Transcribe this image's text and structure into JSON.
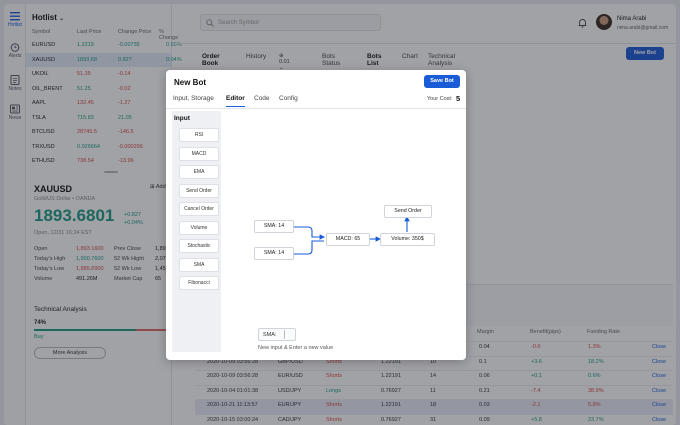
{
  "rail": {
    "items": [
      {
        "label": "Hotlist",
        "icon": "list-icon"
      },
      {
        "label": "Alerts",
        "icon": "alarm-clock-icon"
      },
      {
        "label": "Notes",
        "icon": "notes-icon"
      },
      {
        "label": "News",
        "icon": "news-icon"
      }
    ]
  },
  "hotlist": {
    "title": "Hotlist",
    "headers": [
      "Symbol",
      "Last Price",
      "Change Price",
      "% Change"
    ],
    "rows": [
      {
        "symbol": "EURUSD",
        "last": "1.2219",
        "change": "-0.00735",
        "pct": "0.60%",
        "dir": "up"
      },
      {
        "symbol": "XAUUSD",
        "last": "1893.68",
        "change": "0.827",
        "pct": "0.04%",
        "dir": "up"
      },
      {
        "symbol": "UKOIL",
        "last": "51.35",
        "change": "-0.14",
        "pct": "-0.27%",
        "dir": "down"
      },
      {
        "symbol": "OIL_BRENT",
        "last": "51.25",
        "change": "-0.02",
        "pct": "-0.04%",
        "dir": "mixed"
      },
      {
        "symbol": "AAPL",
        "last": "132.45",
        "change": "-1.27",
        "pct": "-0.95%",
        "dir": "down"
      },
      {
        "symbol": "TSLA",
        "last": "715.83",
        "change": "21.05",
        "pct": "3.03%",
        "dir": "up"
      },
      {
        "symbol": "BTCUSD",
        "last": "28745.5",
        "change": "-146.5",
        "pct": "-0.51%",
        "dir": "down"
      },
      {
        "symbol": "TRXUSD",
        "last": "0.026664",
        "change": "-0.000296",
        "pct": "-1.10%",
        "dir": "mixed"
      },
      {
        "symbol": "ETHUSD",
        "last": "738.54",
        "change": "-13.96",
        "pct": "-1.86%",
        "dir": "down"
      }
    ]
  },
  "detail": {
    "symbol": "XAUUSD",
    "add_label": "Add",
    "subtitle": "Gold/US Dollar • OANDA",
    "price": "1893.6801",
    "change_abs": "+0.827",
    "change_pct": "+0.04%",
    "open_time": "Open, 12/31  16:24 EST",
    "stats_left": [
      {
        "label": "Open",
        "value": "1,893.1600"
      },
      {
        "label": "Today's High",
        "value": "1,900.7600"
      },
      {
        "label": "Today's Low",
        "value": "1,885.6900"
      },
      {
        "label": "Volume",
        "value": "491.26M"
      }
    ],
    "stats_right": [
      {
        "label": "Prev Close",
        "value": "1,893"
      },
      {
        "label": "52 Wk Hight",
        "value": "2,072"
      },
      {
        "label": "52 Wk Low",
        "value": "1,451"
      },
      {
        "label": "Market Cap",
        "value": "65"
      }
    ],
    "ta_title": "Technical Analysis",
    "ta_pct": "74%",
    "ta_label": "Buy",
    "ta_fraction": 0.74,
    "more_label": "More Analysis"
  },
  "topbar": {
    "search_placeholder": "Search Symbol",
    "user_name": "Nima Arabi",
    "user_email": "nima.arabi@gmail.com"
  },
  "tabs_left": {
    "items": [
      "Order Book",
      "History"
    ],
    "step_value": "0.01"
  },
  "tabs_right": {
    "items": [
      "Bots Status",
      "Bots List",
      "Chart",
      "Technical Analysis"
    ],
    "new_bot_label": "New Bot"
  },
  "modal": {
    "title": "New Bot",
    "save_label": "Save Bot",
    "tabs": [
      "Input, Storage",
      "Editor",
      "Code",
      "Config"
    ],
    "your_cost_label": "Your Cost:",
    "your_cost_value": "5",
    "palette_title": "Input",
    "palette": [
      "RSI",
      "MACD",
      "EMA",
      "Send Order",
      "Cancel Order",
      "Volume",
      "Stochastic",
      "SMA",
      "Fibonacci"
    ],
    "nodes": {
      "sma1": "SMA: 14",
      "sma2": "SMA: 14",
      "macd": "MACD: 65",
      "volume": "Volume: 350$",
      "send": "Send Order"
    },
    "input_label": "SMA:",
    "input_hint": "New input & Enter a new value"
  },
  "bottom_table": {
    "headers": [
      "Margin",
      "Benefit(pips)",
      "Funding Rate"
    ],
    "rows": [
      {
        "date": "",
        "pair": "",
        "side": "",
        "price": "",
        "qty": "14",
        "margin": "0.04",
        "benefit": "-0.6",
        "rate": "1.3%",
        "action": "Close",
        "bdir": "down",
        "rdir": "down",
        "sdir": "long"
      },
      {
        "date": "2020-10-09 03:56:28",
        "pair": "GBP/USD",
        "side": "Shorts",
        "price": "1.22191",
        "qty": "10",
        "margin": "0.1",
        "benefit": "+3.6",
        "rate": "18.2%",
        "action": "Close",
        "bdir": "up",
        "rdir": "up",
        "sdir": "short"
      },
      {
        "date": "2020-10-09 03:56:28",
        "pair": "EUR/USD",
        "side": "Shorts",
        "price": "1.22191",
        "qty": "14",
        "margin": "0.06",
        "benefit": "+0.1",
        "rate": "0.6%",
        "action": "Close",
        "bdir": "up",
        "rdir": "up",
        "sdir": "short"
      },
      {
        "date": "2020-10-04 01:01:38",
        "pair": "USD/JPY",
        "side": "Longs",
        "price": "0.76927",
        "qty": "11",
        "margin": "0.21",
        "benefit": "-7.4",
        "rate": "38.9%",
        "action": "Close",
        "bdir": "down",
        "rdir": "down",
        "sdir": "long"
      },
      {
        "date": "2020-10-21 11:13:57",
        "pair": "EUR/JPY",
        "side": "Shorts",
        "price": "1.22191",
        "qty": "18",
        "margin": "0.03",
        "benefit": "-2.1",
        "rate": "5.8%",
        "action": "Close",
        "bdir": "down",
        "rdir": "down",
        "sdir": "short"
      },
      {
        "date": "2020-10-15 03:00:24",
        "pair": "CAD/JPY",
        "side": "Shorts",
        "price": "0.76927",
        "qty": "31",
        "margin": "0.09",
        "benefit": "+5.8",
        "rate": "23.7%",
        "action": "Close",
        "bdir": "up",
        "rdir": "up",
        "sdir": "short"
      }
    ]
  },
  "colors": {
    "accent": "#1a5bd8",
    "up": "#1c9a83",
    "down": "#d64848"
  }
}
